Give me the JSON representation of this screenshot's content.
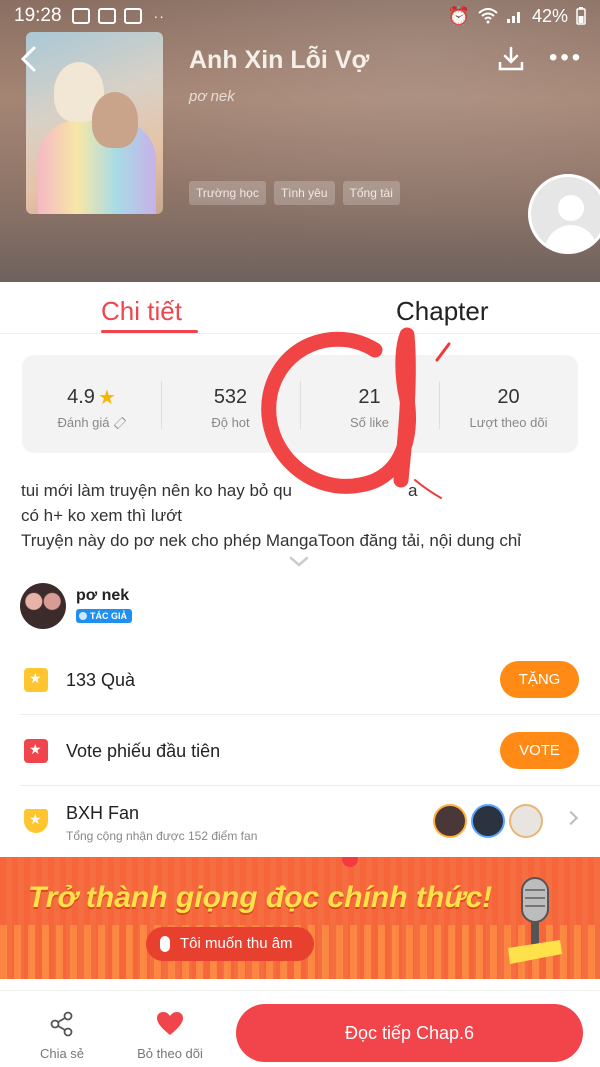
{
  "status_bar": {
    "time": "19:28",
    "dots": "··",
    "battery": "42%"
  },
  "header": {
    "title": "Anh Xin Lỗi Vợ",
    "author": "pơ nek",
    "tags": [
      "Trường học",
      "Tình yêu",
      "Tổng tài"
    ]
  },
  "tabs": {
    "details": "Chi tiết",
    "chapter": "Chapter"
  },
  "stats": [
    {
      "value": "4.9",
      "label": "Đánh giá"
    },
    {
      "value": "532",
      "label": "Độ hot"
    },
    {
      "value": "21",
      "label": "Số like"
    },
    {
      "value": "20",
      "label": "Lượt theo dõi"
    }
  ],
  "description": {
    "line1": "tui mới làm truyện nên ko hay bỏ qu",
    "line1_tail": "a",
    "line2": "có h+ ko xem thì lướt",
    "line3": "Truyện này do pơ nek cho phép MangaToon đăng tải, nội dung chỉ"
  },
  "author_row": {
    "name": "pơ nek",
    "badge": "TÁC GIẢ"
  },
  "gifts": {
    "label": "133  Quà",
    "button": "TẶNG"
  },
  "vote": {
    "label": "Vote phiếu đầu tiên",
    "button": "VOTE"
  },
  "fan_rank": {
    "label": "BXH Fan",
    "sub": "Tổng cộng nhận được 152 điểm fan"
  },
  "banner": {
    "title": "Trở thành giọng đọc chính thức!",
    "button": "Tôi muốn thu âm"
  },
  "bottom_bar": {
    "share": "Chia sẻ",
    "unfollow": "Bỏ theo dõi",
    "read": "Đọc tiếp Chap.6"
  },
  "colors": {
    "accent": "#f0454c",
    "orange": "#ff8b16",
    "banner": "#f7653b"
  }
}
